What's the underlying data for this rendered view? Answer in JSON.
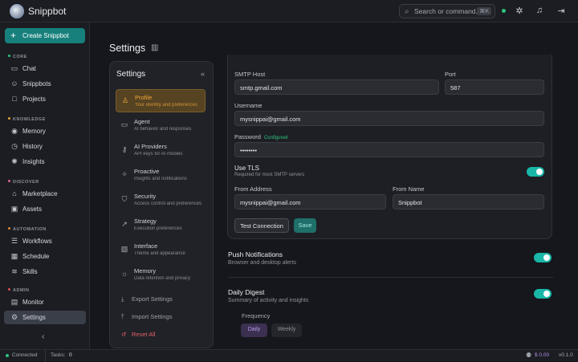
{
  "app": {
    "name": "Snippbot"
  },
  "search": {
    "placeholder": "Search or command...",
    "shortcut": "⌘K"
  },
  "topbar": {
    "icons": [
      "bug-icon",
      "bell-icon",
      "logout-icon"
    ]
  },
  "sidebar": {
    "create_label": "Create Snippbot",
    "sections": {
      "core": "CORE",
      "knowledge": "KNOWLEDGE",
      "discover": "DISCOVER",
      "automation": "AUTOMATION",
      "admin": "ADMIN"
    },
    "section_colors": {
      "core": "#2ec27e",
      "knowledge": "#e0a030",
      "discover": "#e060a0",
      "automation": "#e08030",
      "admin": "#e05050"
    },
    "items": {
      "chat": "Chat",
      "snippbots": "Snippbots",
      "projects": "Projects",
      "memory": "Memory",
      "history": "History",
      "insights": "Insights",
      "marketplace": "Marketplace",
      "assets": "Assets",
      "workflows": "Workflows",
      "schedule": "Schedule",
      "skills": "Skills",
      "monitor": "Monitor",
      "settings": "Settings"
    }
  },
  "page": {
    "title": "Settings"
  },
  "settings_panel": {
    "title": "Settings",
    "items": [
      {
        "title": "Profile",
        "sub": "Your identity and preferences"
      },
      {
        "title": "Agent",
        "sub": "AI behavior and responses"
      },
      {
        "title": "AI Providers",
        "sub": "API keys for AI models"
      },
      {
        "title": "Proactive",
        "sub": "Insights and notifications"
      },
      {
        "title": "Security",
        "sub": "Access control and preferences"
      },
      {
        "title": "Strategy",
        "sub": "Execution preferences"
      },
      {
        "title": "Interface",
        "sub": "Theme and appearance"
      },
      {
        "title": "Memory",
        "sub": "Data retention and privacy"
      }
    ],
    "export": "Export Settings",
    "import": "Import Settings",
    "reset": "Reset All"
  },
  "smtp": {
    "host_label": "SMTP Host",
    "host_value": "smtp.gmail.com",
    "port_label": "Port",
    "port_value": "587",
    "username_label": "Username",
    "username_value": "mysnippai@gmail.com",
    "password_label": "Password",
    "password_status": "Configured",
    "password_value": "••••••••",
    "tls_label": "Use TLS",
    "tls_sub": "Required for most SMTP servers",
    "tls_on": true,
    "from_address_label": "From Address",
    "from_address_value": "mysnippai@gmail.com",
    "from_name_label": "From Name",
    "from_name_value": "Snippbot",
    "test_label": "Test Connection",
    "save_label": "Save"
  },
  "push": {
    "title": "Push Notifications",
    "sub": "Browser and desktop alerts",
    "on": true
  },
  "digest": {
    "title": "Daily Digest",
    "sub": "Summary of activity and insights",
    "on": true,
    "frequency_label": "Frequency",
    "options": [
      "Daily",
      "Weekly"
    ],
    "selected": "Daily"
  },
  "footer": {
    "status": "Connected",
    "tasks_label": "Tasks:",
    "tasks_value": "0",
    "cost": "$ 0.00",
    "version": "v0.1.0"
  }
}
